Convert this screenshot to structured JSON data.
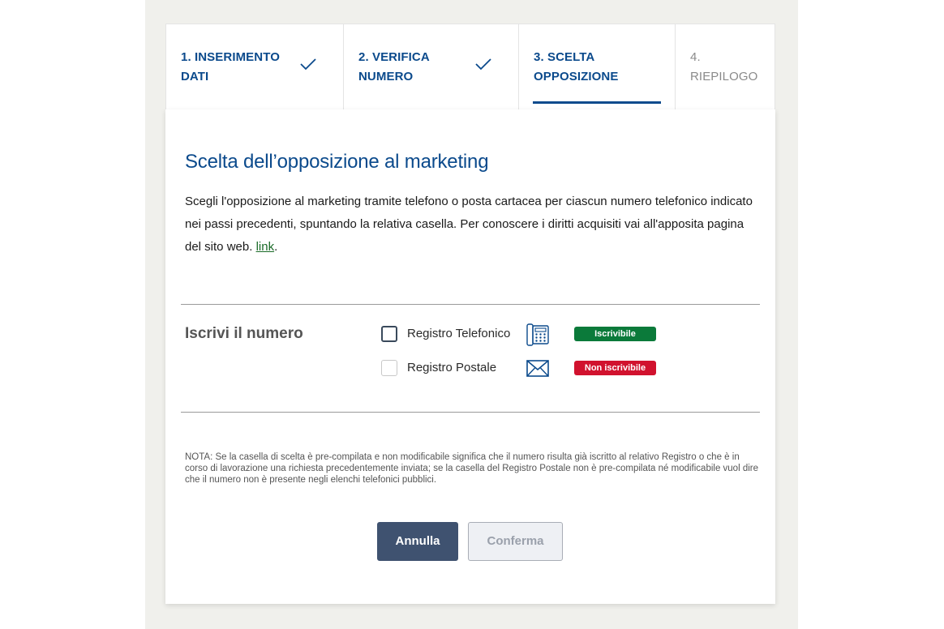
{
  "steps": [
    {
      "label": "1. INSERIMENTO DATI",
      "line1": "1. INSERIMENTO",
      "line2": "DATI",
      "state": "completed"
    },
    {
      "label": "2. VERIFICA NUMERO",
      "line1": "2. VERIFICA",
      "line2": "NUMERO",
      "state": "completed"
    },
    {
      "label": "3. SCELTA OPPOSIZIONE",
      "line1": "3. SCELTA",
      "line2": "OPPOSIZIONE",
      "state": "active"
    },
    {
      "label": "4. RIEPILOGO",
      "line1": "4.",
      "line2": "RIEPILOGO",
      "state": "pending"
    }
  ],
  "card": {
    "title": "Scelta dell’opposizione al marketing",
    "description": "Scegli l'opposizione al marketing tramite telefono o posta cartacea per ciascun numero telefonico indicato nei passi precedenti, spuntando la relativa casella. Per conoscere i diritti acquisiti vai all'apposita pagina del sito web.",
    "link_text": "link",
    "link_suffix": "."
  },
  "registration": {
    "heading": "Iscrivi il numero",
    "options": [
      {
        "label": "Registro Telefonico",
        "icon": "telephone-icon",
        "badge": "Iscrivibile",
        "badge_color": "#0b7a3a",
        "checked": false,
        "enabled": true
      },
      {
        "label": "Registro Postale",
        "icon": "envelope-icon",
        "badge": "Non iscrivibile",
        "badge_color": "#d1122e",
        "checked": false,
        "enabled": false
      }
    ]
  },
  "note": "NOTA: Se la casella di scelta è pre-compilata e non modificabile significa che il numero risulta già iscritto al relativo Registro o che è in corso di lavorazione una richiesta precedentemente inviata; se la casella del Registro Postale non è pre-compilata né modificabile vuol dire che il numero non è presente negli elenchi telefonici pubblici.",
  "buttons": {
    "cancel": "Annulla",
    "confirm": "Conferma"
  },
  "colors": {
    "primary": "#0b4a8c",
    "success": "#0b7a3a",
    "danger": "#d1122e",
    "button_dark": "#3f5270"
  }
}
